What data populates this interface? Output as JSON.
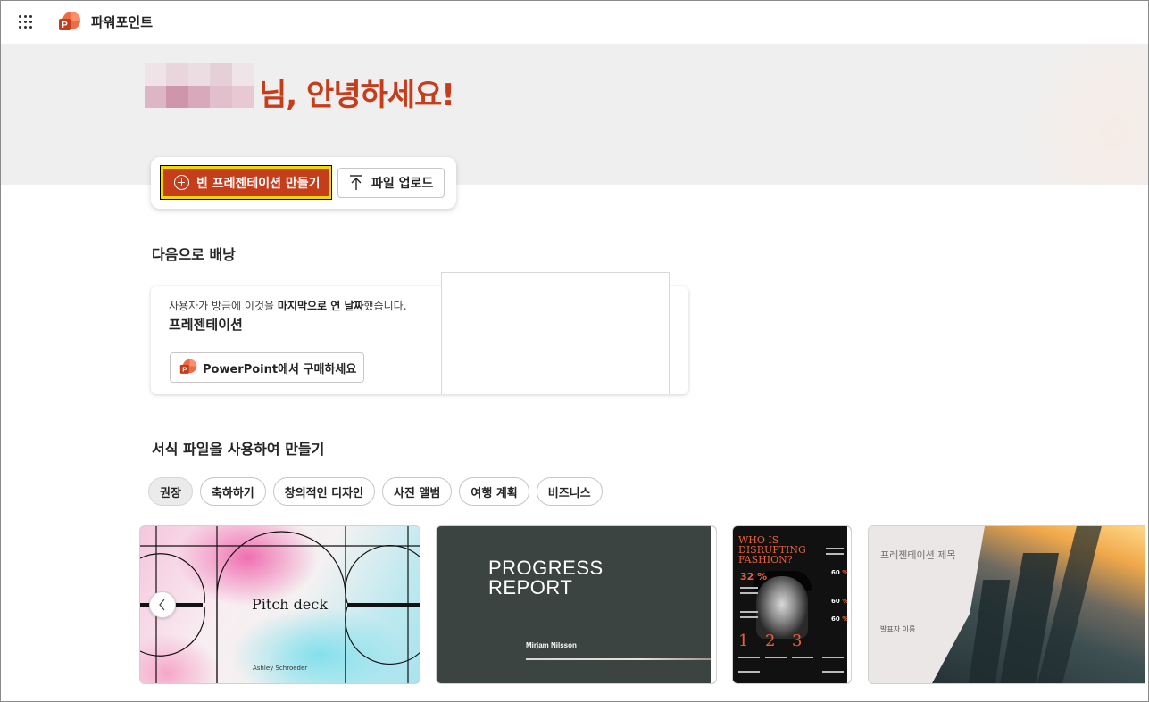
{
  "app": {
    "title": "파워포인트",
    "colors": {
      "accent": "#c43e1c",
      "focus_ring": "#f5d700",
      "hero_bg": "#f0efef"
    }
  },
  "icons": {
    "app_launcher": "waffle-grid-icon",
    "app_logo": "powerpoint-logo-icon",
    "new": "add-circle-icon",
    "upload": "upload-arrow-icon",
    "carousel_prev": "chevron-left-icon"
  },
  "hero": {
    "greeting": "님, 안녕하세요!"
  },
  "actions": {
    "new_label": "빈 프레젠테이션 만들기",
    "upload_label": "파일 업로드"
  },
  "pickup": {
    "section_title": "다음으로 배낭",
    "desc_prefix": "사용자가 방금에 이것을 ",
    "desc_bold": "마지막으로 연 날짜",
    "desc_suffix": "했습니다.",
    "file_name": "프레젠테이션",
    "buy_label": "PowerPoint에서 구매하세요"
  },
  "templates": {
    "section_title": "서식 파일을 사용하여 만들기",
    "chips": [
      {
        "label": "권장",
        "selected": true
      },
      {
        "label": "축하하기",
        "selected": false
      },
      {
        "label": "창의적인 디자인",
        "selected": false
      },
      {
        "label": "사진 앨범",
        "selected": false
      },
      {
        "label": "여행 계획",
        "selected": false
      },
      {
        "label": "비즈니스",
        "selected": false
      }
    ],
    "items": [
      {
        "title": "Pitch deck",
        "subtitle": "Ashley Schroeder"
      },
      {
        "title_line1": "PROGRESS",
        "title_line2": "REPORT",
        "subtitle": "Mirjam Nilsson"
      },
      {
        "title": "WHO IS DISRUPTING FASHION?",
        "stat1": "32",
        "stat2": "60",
        "big_nums": [
          "1",
          "2",
          "3"
        ]
      },
      {
        "title": "프레젠테이션 제목",
        "subtitle": "발표자 이름"
      }
    ]
  }
}
